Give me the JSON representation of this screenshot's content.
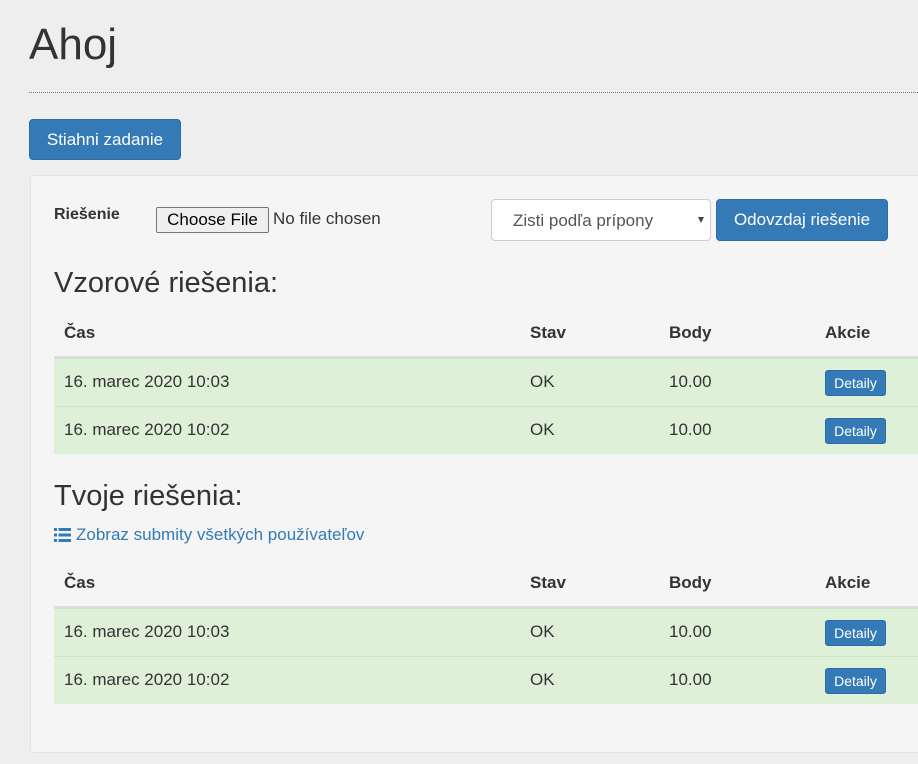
{
  "page": {
    "title": "Ahoj"
  },
  "toolbar": {
    "download_label": "Stiahni zadanie"
  },
  "upload": {
    "label": "Riešenie",
    "choose_file_label": "Choose File",
    "file_status": "No file chosen",
    "language_selected": "Zisti podľa prípony",
    "submit_label": "Odovzdaj riešenie"
  },
  "columns": {
    "time": "Čas",
    "status": "Stav",
    "points": "Body",
    "actions": "Akcie"
  },
  "reference": {
    "title": "Vzorové riešenia:",
    "rows": [
      {
        "time": "16. marec 2020 10:03",
        "status": "OK",
        "points": "10.00",
        "action": "Detaily"
      },
      {
        "time": "16. marec 2020 10:02",
        "status": "OK",
        "points": "10.00",
        "action": "Detaily"
      }
    ]
  },
  "mine": {
    "title": "Tvoje riešenia:",
    "all_link": "Zobraz submity všetkých používateľov",
    "rows": [
      {
        "time": "16. marec 2020 10:03",
        "status": "OK",
        "points": "10.00",
        "action": "Detaily"
      },
      {
        "time": "16. marec 2020 10:02",
        "status": "OK",
        "points": "10.00",
        "action": "Detaily"
      }
    ]
  },
  "colors": {
    "primary": "#337ab7",
    "success_row": "#dff0d8"
  }
}
